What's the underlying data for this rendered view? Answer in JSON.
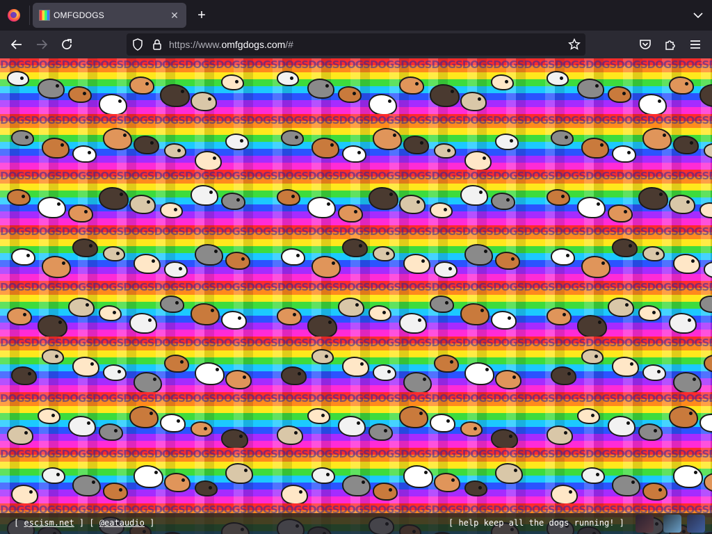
{
  "browser": {
    "tab": {
      "title": "OMFGDOGS",
      "close_glyph": "✕"
    },
    "new_tab_glyph": "+",
    "url": {
      "scheme": "https://www.",
      "host": "omfgdogs.com",
      "path": "/#"
    }
  },
  "content": {
    "background_word": "DOGS",
    "colors": {
      "bg": "#1c1b22",
      "toolbar": "#2b2a33",
      "tab_active": "#42414d",
      "text": "#fbfbfe"
    }
  },
  "footer": {
    "left_open": "[ ",
    "link1": "escism.net",
    "mid": " ] [ ",
    "link2": "@eataudio",
    "left_close": " ]",
    "right": "[ help keep all the dogs running! ]"
  }
}
